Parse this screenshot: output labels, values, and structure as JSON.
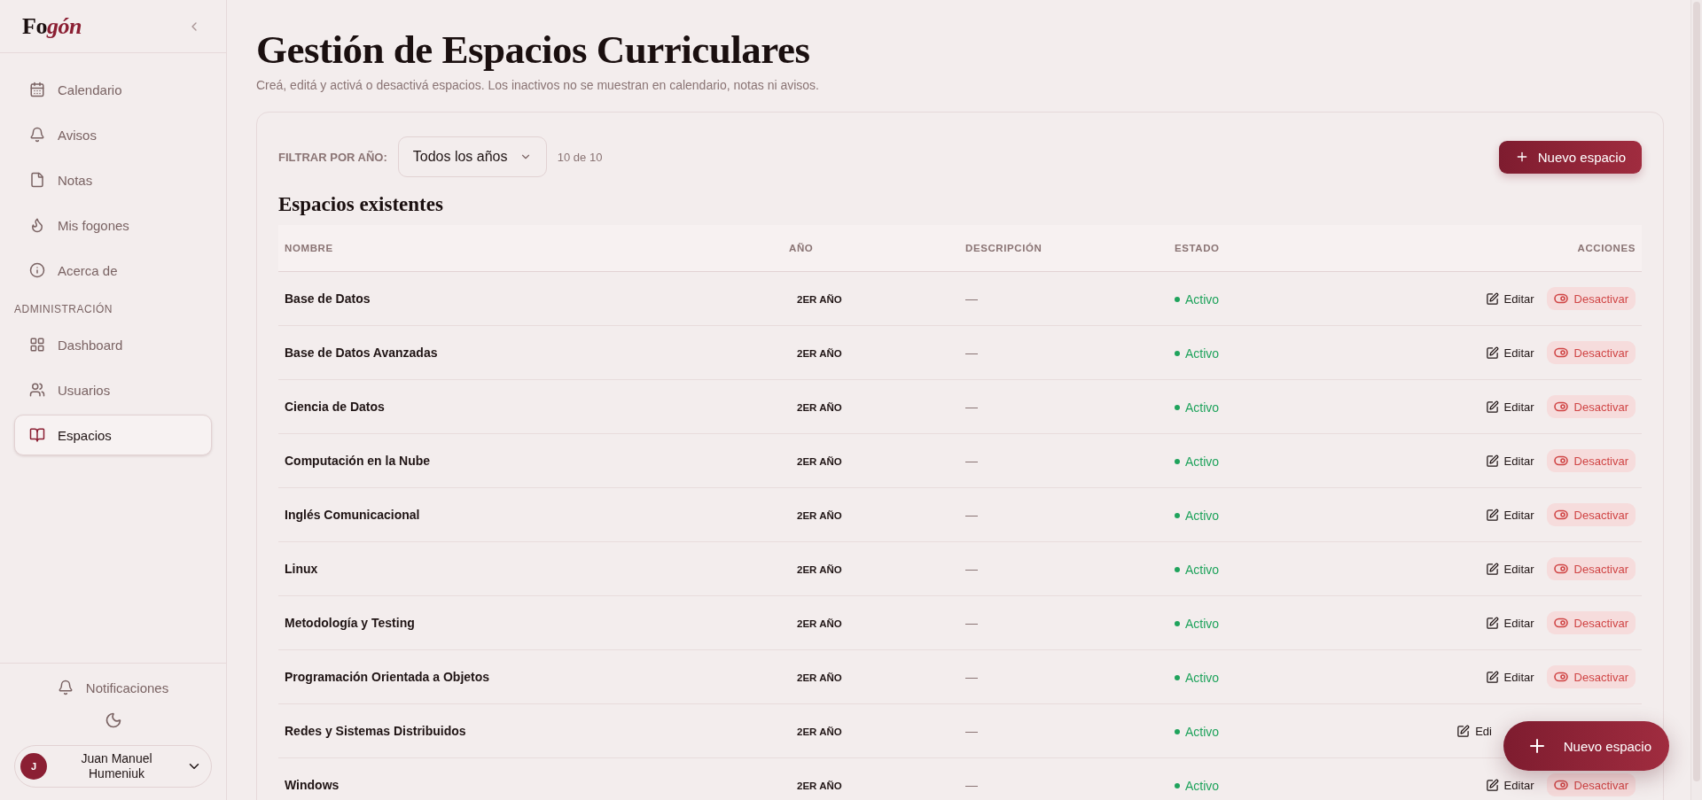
{
  "sidebar": {
    "logo_start": "Fo",
    "logo_accent": "gón",
    "nav": [
      {
        "label": "Calendario",
        "selected": false
      },
      {
        "label": "Avisos",
        "selected": false
      },
      {
        "label": "Notas",
        "selected": false
      },
      {
        "label": "Mis fogones",
        "selected": false
      },
      {
        "label": "Acerca de",
        "selected": false
      }
    ],
    "admin_heading": "ADMINISTRACIÓN",
    "admin_nav": [
      {
        "label": "Dashboard",
        "selected": false
      },
      {
        "label": "Usuarios",
        "selected": false
      },
      {
        "label": "Espacios",
        "selected": true
      }
    ],
    "notifications": "Notificaciones",
    "user": {
      "initial": "J",
      "name": "Juan Manuel Humeniuk"
    }
  },
  "main": {
    "title": "Gestión de Espacios Curriculares",
    "subtitle": "Creá, editá y activá o desactivá espacios. Los inactivos no se muestran en calendario, notas ni avisos.",
    "filter": {
      "label": "FILTRAR POR AÑO:",
      "value": "Todos los años",
      "count": "10 de 10"
    },
    "new_button": "Nuevo espacio",
    "section_title": "Espacios existentes",
    "table": {
      "columns": [
        "NOMBRE",
        "AÑO",
        "DESCRIPCIÓN",
        "ESTADO",
        "ACCIONES"
      ],
      "rows": [
        {
          "name": "Base de Datos",
          "year": "2ER AÑO",
          "description": "—",
          "status": "Activo",
          "active": true,
          "edit": "Editar",
          "deactivate": "Desactivar"
        },
        {
          "name": "Base de Datos Avanzadas",
          "year": "2ER AÑO",
          "description": "—",
          "status": "Activo",
          "active": true,
          "edit": "Editar",
          "deactivate": "Desactivar"
        },
        {
          "name": "Ciencia de Datos",
          "year": "2ER AÑO",
          "description": "—",
          "status": "Activo",
          "active": true,
          "edit": "Editar",
          "deactivate": "Desactivar"
        },
        {
          "name": "Computación en la Nube",
          "year": "2ER AÑO",
          "description": "—",
          "status": "Activo",
          "active": true,
          "edit": "Editar",
          "deactivate": "Desactivar"
        },
        {
          "name": "Inglés Comunicacional",
          "year": "2ER AÑO",
          "description": "—",
          "status": "Activo",
          "active": true,
          "edit": "Editar",
          "deactivate": "Desactivar"
        },
        {
          "name": "Linux",
          "year": "2ER AÑO",
          "description": "—",
          "status": "Activo",
          "active": true,
          "edit": "Editar",
          "deactivate": "Desactivar"
        },
        {
          "name": "Metodología y Testing",
          "year": "2ER AÑO",
          "description": "—",
          "status": "Activo",
          "active": true,
          "edit": "Editar",
          "deactivate": "Desactivar"
        },
        {
          "name": "Programación Orientada a Objetos",
          "year": "2ER AÑO",
          "description": "—",
          "status": "Activo",
          "active": true,
          "edit": "Editar",
          "deactivate": "Desactivar"
        },
        {
          "name": "Redes y Sistemas Distribuidos",
          "year": "2ER AÑO",
          "description": "—",
          "status": "Activo",
          "active": true,
          "edit": "Edi"
        },
        {
          "name": "Windows",
          "year": "2ER AÑO",
          "description": "—",
          "status": "Activo",
          "active": true,
          "edit": "Editar",
          "deactivate": "Desactivar"
        }
      ]
    },
    "fab": {
      "label": "Nuevo espacio"
    }
  }
}
